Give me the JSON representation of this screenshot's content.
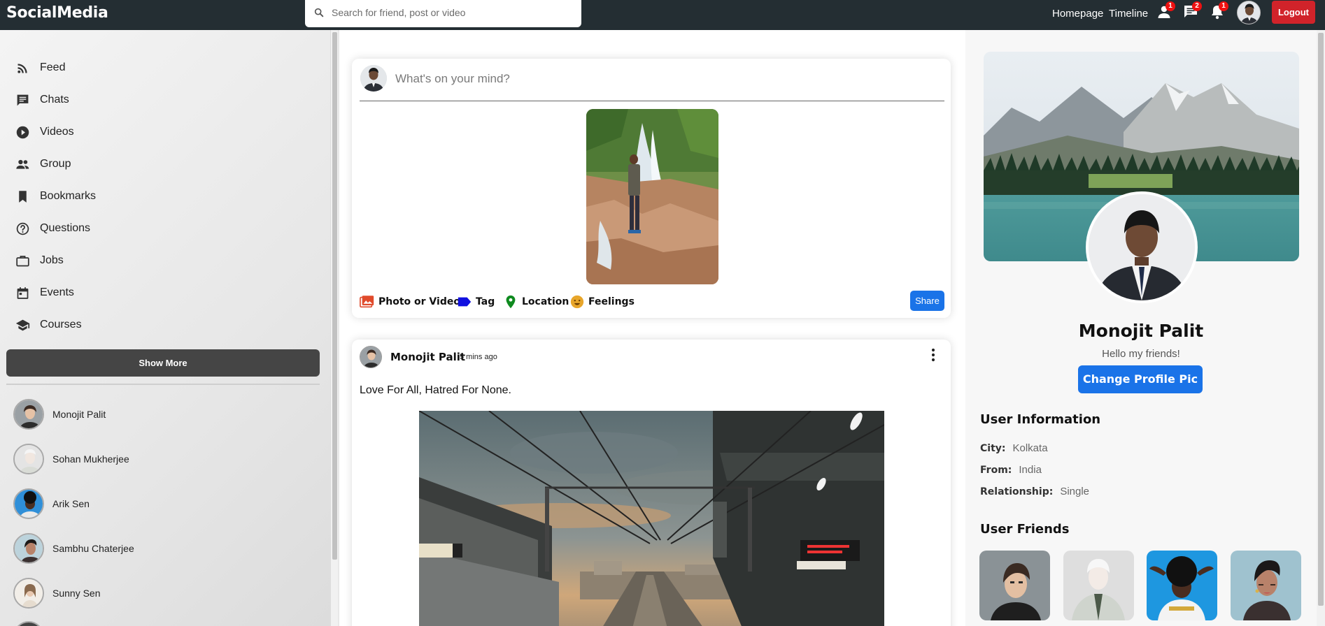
{
  "app": {
    "logo": "SocialMedia"
  },
  "search": {
    "placeholder": "Search for friend, post or video"
  },
  "topnav": {
    "homepage": "Homepage",
    "timeline": "Timeline",
    "friend_requests_count": "1",
    "messages_count": "2",
    "notifications_count": "1",
    "logout": "Logout"
  },
  "sidebar": {
    "items": [
      {
        "label": "Feed",
        "icon": "rss-icon"
      },
      {
        "label": "Chats",
        "icon": "chat-icon"
      },
      {
        "label": "Videos",
        "icon": "play-circle-icon"
      },
      {
        "label": "Group",
        "icon": "group-icon"
      },
      {
        "label": "Bookmarks",
        "icon": "bookmark-icon"
      },
      {
        "label": "Questions",
        "icon": "help-circle-icon"
      },
      {
        "label": "Jobs",
        "icon": "briefcase-icon"
      },
      {
        "label": "Events",
        "icon": "calendar-icon"
      },
      {
        "label": "Courses",
        "icon": "school-icon"
      }
    ],
    "show_more": "Show More",
    "friends": [
      {
        "name": "Monojit Palit"
      },
      {
        "name": "Sohan Mukherjee"
      },
      {
        "name": "Arik Sen"
      },
      {
        "name": "Sambhu Chaterjee"
      },
      {
        "name": "Sunny Sen"
      }
    ]
  },
  "share": {
    "placeholder": "What's on your mind?",
    "options": {
      "photo": "Photo or Video",
      "tag": "Tag",
      "location": "Location",
      "feelings": "Feelings"
    },
    "share_button": "Share"
  },
  "post": {
    "username": "Monojit Palit",
    "time": "5 mins ago",
    "text": "Love For All, Hatred For None."
  },
  "profile": {
    "name": "Monojit Palit",
    "bio": "Hello my friends!",
    "change_pic": "Change Profile Pic",
    "info_title": "User Information",
    "city_label": "City:",
    "city": "Kolkata",
    "from_label": "From:",
    "from": "India",
    "relationship_label": "Relationship:",
    "relationship": "Single",
    "friends_title": "User Friends"
  },
  "colors": {
    "topbar": "#242e33",
    "accent_blue": "#1a73e8",
    "logout_red": "#d1232a",
    "badge_red": "#ee1111"
  }
}
